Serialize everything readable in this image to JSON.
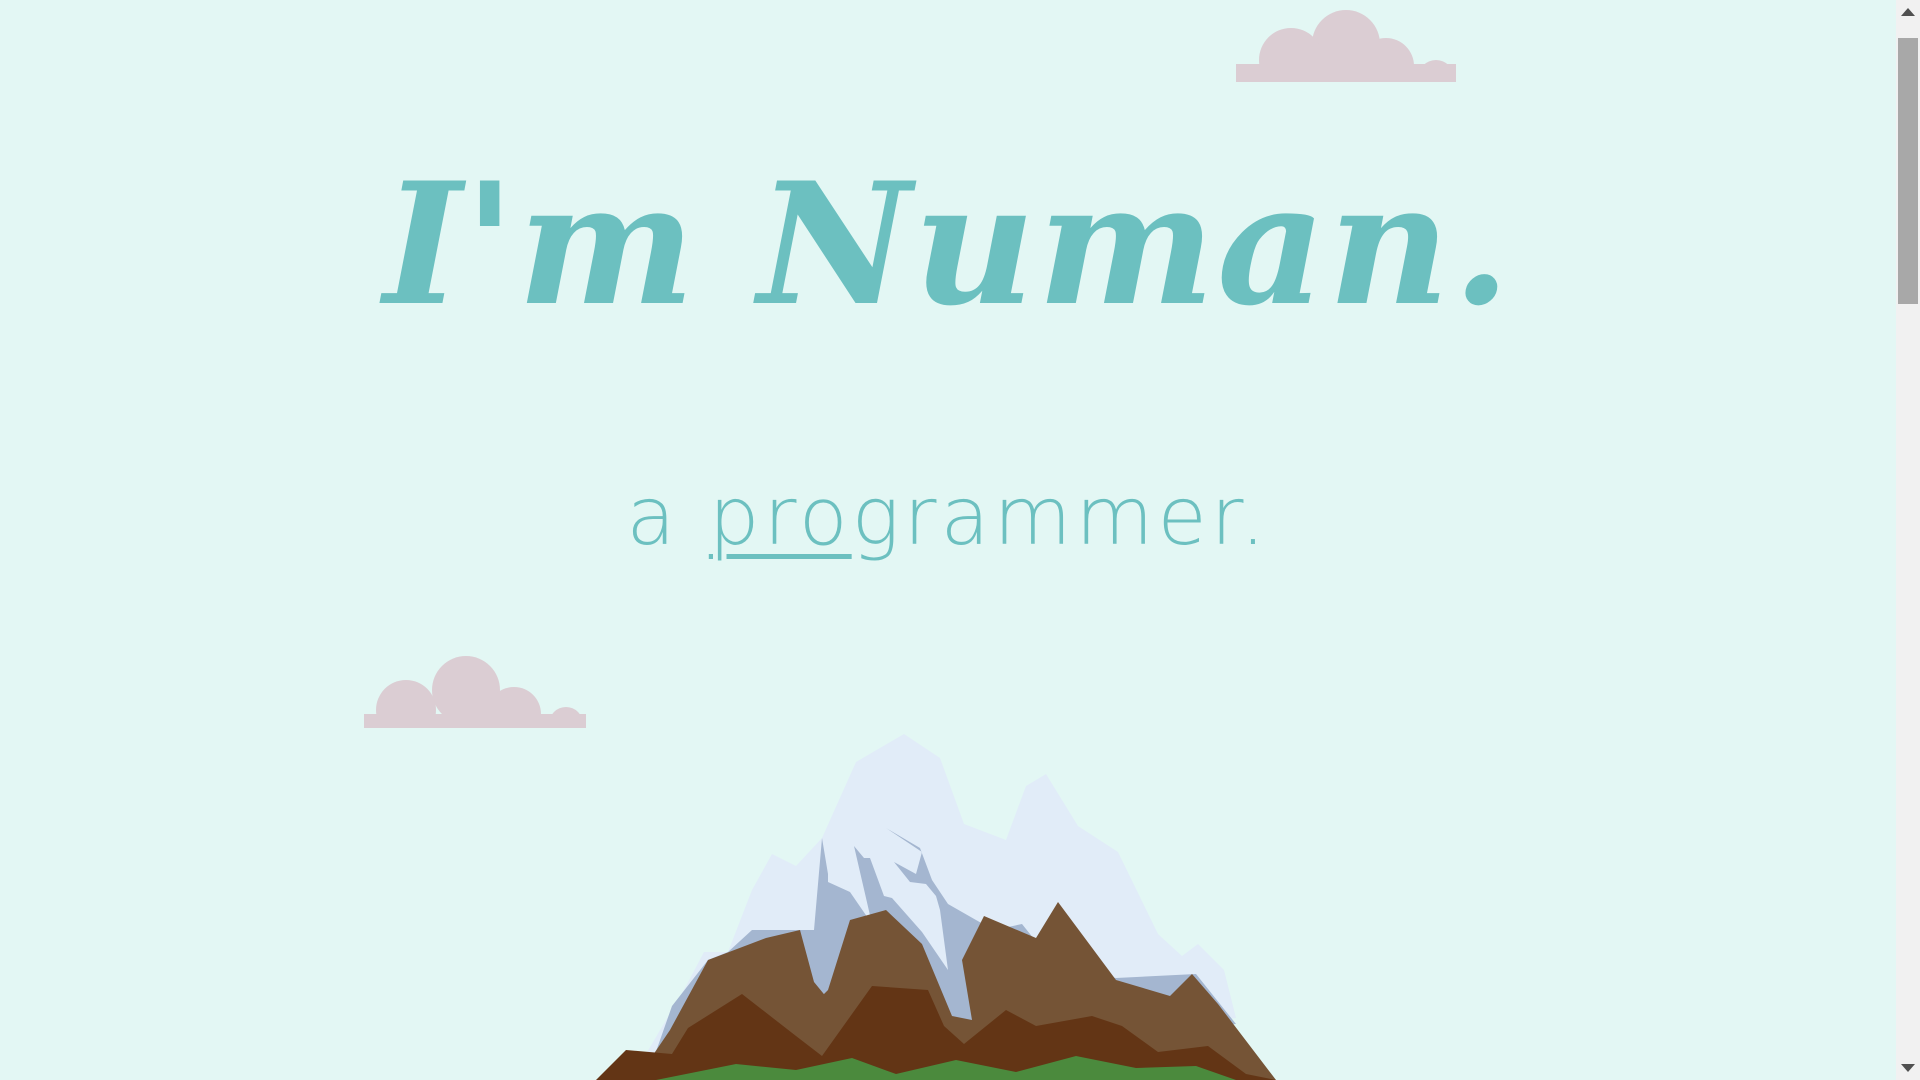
{
  "hero": {
    "title": "I'm Numan.",
    "subtitle_prefix": "a ",
    "subtitle_link": "pro",
    "subtitle_suffix": "grammer."
  },
  "colors": {
    "background": "#e3f7f4",
    "accent": "#6cc0c0",
    "cloud": "#dbcdd3",
    "snow": "#e1ecf8",
    "snow_shadow": "#a4b6d0",
    "rock_light": "#755436",
    "rock_dark": "#633515",
    "grass": "#4b8a3d"
  },
  "icons": {
    "scroll_up": "triangle-up",
    "scroll_down": "triangle-down"
  }
}
